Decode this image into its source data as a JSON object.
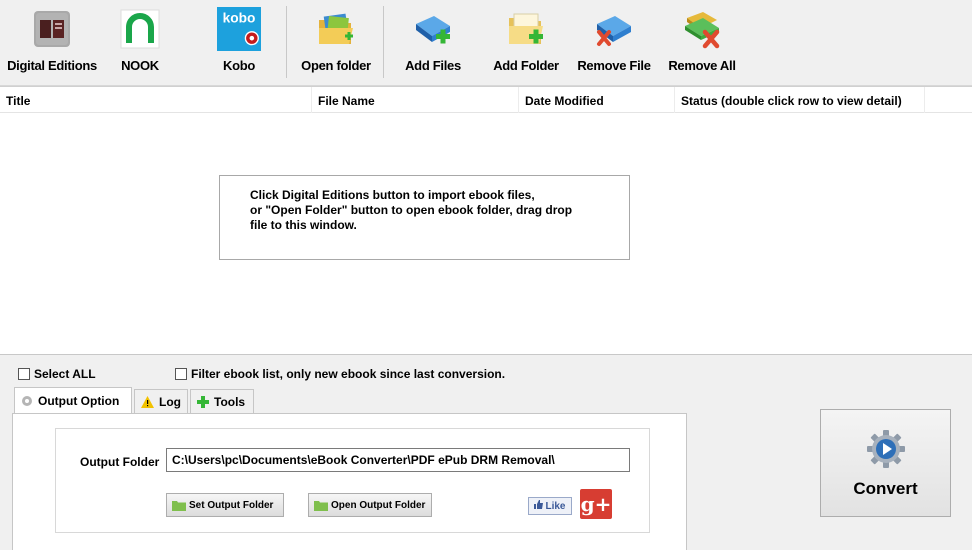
{
  "toolbar": {
    "digital_editions": "Digital Editions",
    "nook": "NOOK",
    "kobo": "Kobo",
    "kobo_logo_text": "kobo",
    "open_folder": "Open folder",
    "add_files": "Add Files",
    "add_folder": "Add Folder",
    "remove_file": "Remove File",
    "remove_all": "Remove All"
  },
  "list": {
    "columns": [
      "Title",
      "File Name",
      "Date Modified",
      "Status (double click row to view detail)"
    ],
    "hint_lines": [
      "Click Digital Editions button to import ebook files,",
      "or \"Open Folder\" button to open ebook folder, drag drop",
      "file to this window."
    ]
  },
  "options": {
    "select_all": "Select ALL",
    "filter": "Filter ebook list, only new ebook since last conversion."
  },
  "tabs": [
    "Output Option",
    "Log",
    "Tools"
  ],
  "output": {
    "label": "Output Folder",
    "path": "C:\\Users\\pc\\Documents\\eBook Converter\\PDF ePub DRM Removal\\",
    "set_button": "Set Output Folder",
    "open_button": "Open Output Folder",
    "like": "Like",
    "gplus": "g+"
  },
  "convert": "Convert",
  "icons": {
    "digital_editions": "digital-editions-icon",
    "nook": "nook-icon",
    "kobo": "kobo-icon",
    "open_folder": "open-folder-icon",
    "add_files": "add-files-icon",
    "add_folder": "add-folder-icon",
    "remove_file": "remove-file-icon",
    "remove_all": "remove-all-icon",
    "convert": "gear-play-icon"
  },
  "colors": {
    "nook_green": "#1aa64a",
    "kobo_blue": "#1da1dd",
    "add_green": "#35b636",
    "remove_red": "#e04a2f",
    "gplus_red": "#d73d32"
  }
}
